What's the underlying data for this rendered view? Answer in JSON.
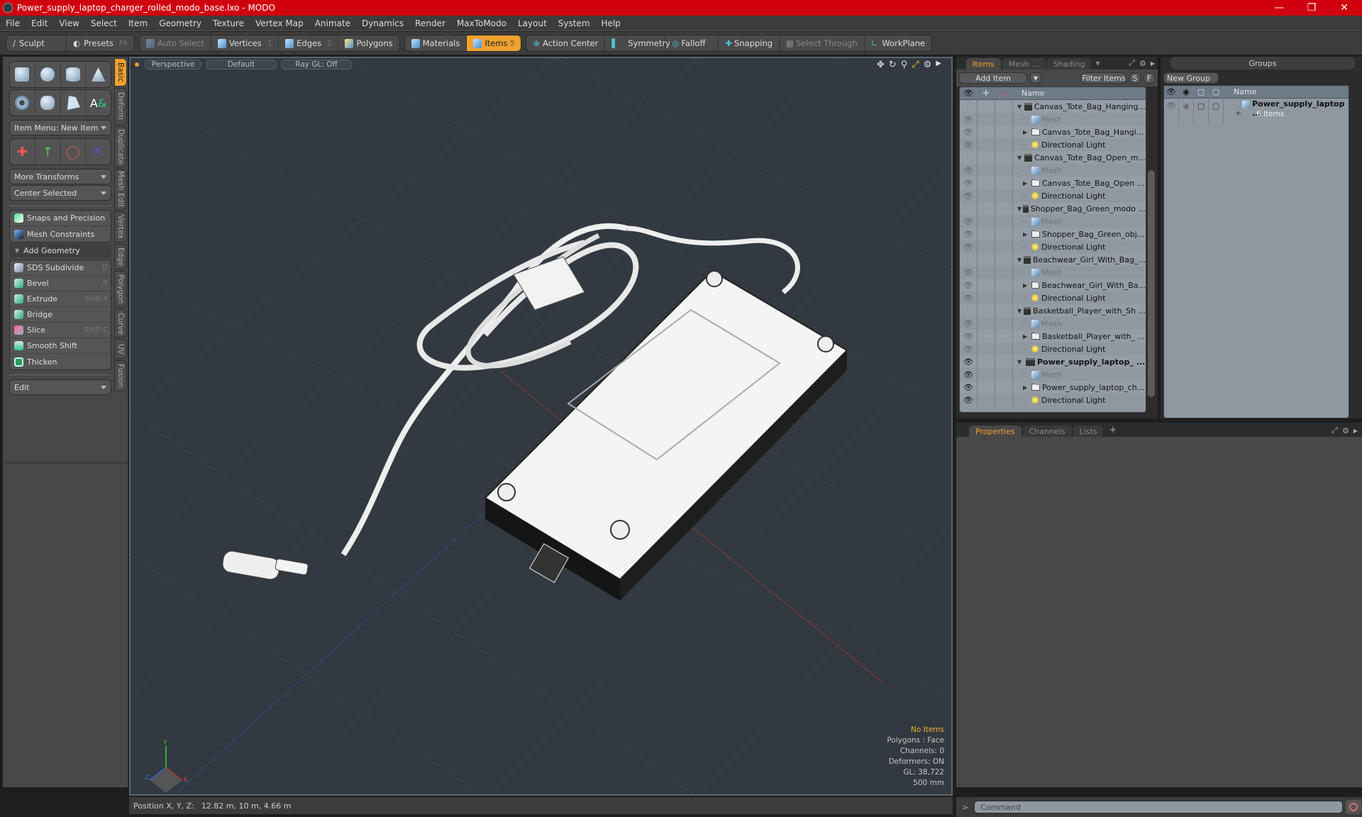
{
  "window": {
    "title": "Power_supply_laptop_charger_rolled_modo_base.lxo - MODO",
    "controls": [
      "minimize",
      "restore",
      "close"
    ]
  },
  "menu": [
    "File",
    "Edit",
    "View",
    "Select",
    "Item",
    "Geometry",
    "Texture",
    "Vertex Map",
    "Animate",
    "Dynamics",
    "Render",
    "MaxToModo",
    "Layout",
    "System",
    "Help"
  ],
  "toolbar": {
    "sculpt": "Sculpt",
    "presets": "Presets",
    "presets_key": "F6",
    "auto_select": "Auto Select",
    "vertices": "Vertices",
    "vertices_key": "1",
    "edges": "Edges",
    "edges_key": "2",
    "polygons": "Polygons",
    "materials": "Materials",
    "items": "Items",
    "items_key": "5",
    "action_center": "Action Center",
    "symmetry": "Symmetry",
    "falloff": "Falloff",
    "snapping": "Snapping",
    "select_through": "Select Through",
    "workplane": "WorkPlane"
  },
  "left_panel": {
    "item_menu": "Item Menu: New Item",
    "more_transforms": "More Transforms",
    "center_selected": "Center Selected",
    "snaps": "Snaps and Precision",
    "mesh_constraints": "Mesh Constraints",
    "add_geometry": "Add Geometry",
    "tools": [
      {
        "label": "SDS Subdivide",
        "shortcut": "D"
      },
      {
        "label": "Bevel",
        "shortcut": "B"
      },
      {
        "label": "Extrude",
        "shortcut": "Shift-X"
      },
      {
        "label": "Bridge",
        "shortcut": ""
      },
      {
        "label": "Slice",
        "shortcut": "Shift-C"
      },
      {
        "label": "Smooth Shift",
        "shortcut": ""
      },
      {
        "label": "Thicken",
        "shortcut": ""
      }
    ],
    "edit_dropdown": "Edit",
    "vertical_tabs": [
      "Basic",
      "Deform",
      "Duplicate",
      "Mesh Edit",
      "Vertex",
      "Edge",
      "Polygon",
      "Curve",
      "UV",
      "Fusion"
    ]
  },
  "viewport": {
    "view": "Perspective",
    "shading": "Default",
    "raygl": "Ray GL: Off",
    "info": {
      "selection": "No Items",
      "polygons": "Polygons : Face",
      "channels": "Channels: 0",
      "deformers": "Deformers: ON",
      "gl": "GL: 38,722",
      "scale": "500 mm"
    },
    "axis": {
      "x": "X",
      "y": "Y",
      "z": "Z"
    }
  },
  "status": {
    "position_label": "Position X, Y, Z:",
    "position_value": "12.82 m, 10 m, 4.66 m"
  },
  "items_panel": {
    "tabs": [
      "Items",
      "Mesh ...",
      "Shading"
    ],
    "add_item": "Add Item",
    "filter_items": "Filter Items",
    "s_btn": "S",
    "f_btn": "F",
    "name_header": "Name",
    "rows": [
      {
        "type": "scene",
        "label": "Canvas_Tote_Bag_Hanging...",
        "visible": null
      },
      {
        "type": "mesh",
        "label": "Mesh",
        "visible": "dim"
      },
      {
        "type": "folder",
        "label": "Canvas_Tote_Bag_Hangi...",
        "visible": "dim"
      },
      {
        "type": "light",
        "label": "Directional Light",
        "visible": "dim"
      },
      {
        "type": "scene",
        "label": "Canvas_Tote_Bag_Open_m...",
        "visible": null
      },
      {
        "type": "mesh",
        "label": "Mesh",
        "visible": "dim"
      },
      {
        "type": "folder",
        "label": "Canvas_Tote_Bag_Open ...",
        "visible": "dim"
      },
      {
        "type": "light",
        "label": "Directional Light",
        "visible": "dim"
      },
      {
        "type": "scene",
        "label": "Shopper_Bag_Green_modo ...",
        "visible": null
      },
      {
        "type": "mesh",
        "label": "Mesh",
        "visible": "dim"
      },
      {
        "type": "folder",
        "label": "Shopper_Bag_Green_obj...",
        "visible": "dim"
      },
      {
        "type": "light",
        "label": "Directional Light",
        "visible": "dim"
      },
      {
        "type": "scene",
        "label": "Beachwear_Girl_With_Bag_...",
        "visible": null
      },
      {
        "type": "mesh",
        "label": "Mesh",
        "visible": "dim"
      },
      {
        "type": "folder",
        "label": "Beachwear_Girl_With_Ba...",
        "visible": "dim"
      },
      {
        "type": "light",
        "label": "Directional Light",
        "visible": "dim"
      },
      {
        "type": "scene",
        "label": "Basketball_Player_with_Sh ...",
        "visible": null
      },
      {
        "type": "mesh",
        "label": "Mesh",
        "visible": "dim"
      },
      {
        "type": "folder",
        "label": "Basketball_Player_with_ ...",
        "visible": "dim"
      },
      {
        "type": "light",
        "label": "Directional Light",
        "visible": "dim"
      },
      {
        "type": "scene",
        "label": "Power_supply_laptop_ ...",
        "visible": "on",
        "bold": true
      },
      {
        "type": "mesh",
        "label": "Mesh",
        "visible": "on"
      },
      {
        "type": "folder",
        "label": "Power_supply_laptop_ch...",
        "visible": "on"
      },
      {
        "type": "light",
        "label": "Directional Light",
        "visible": "on"
      }
    ]
  },
  "groups_panel": {
    "title": "Groups",
    "new_group": "New Group",
    "name_header": "Name",
    "group_name": "Power_supply_laptop ...",
    "group_count": "6 Items"
  },
  "properties_panel": {
    "tabs": [
      "Properties",
      "Channels",
      "Lists"
    ],
    "add_tab": "+"
  },
  "command": {
    "prompt": ">",
    "placeholder": "Command"
  },
  "colors": {
    "titlebar": "#d0000f",
    "accent": "#f0a030",
    "viewport_bg": "#323940"
  }
}
